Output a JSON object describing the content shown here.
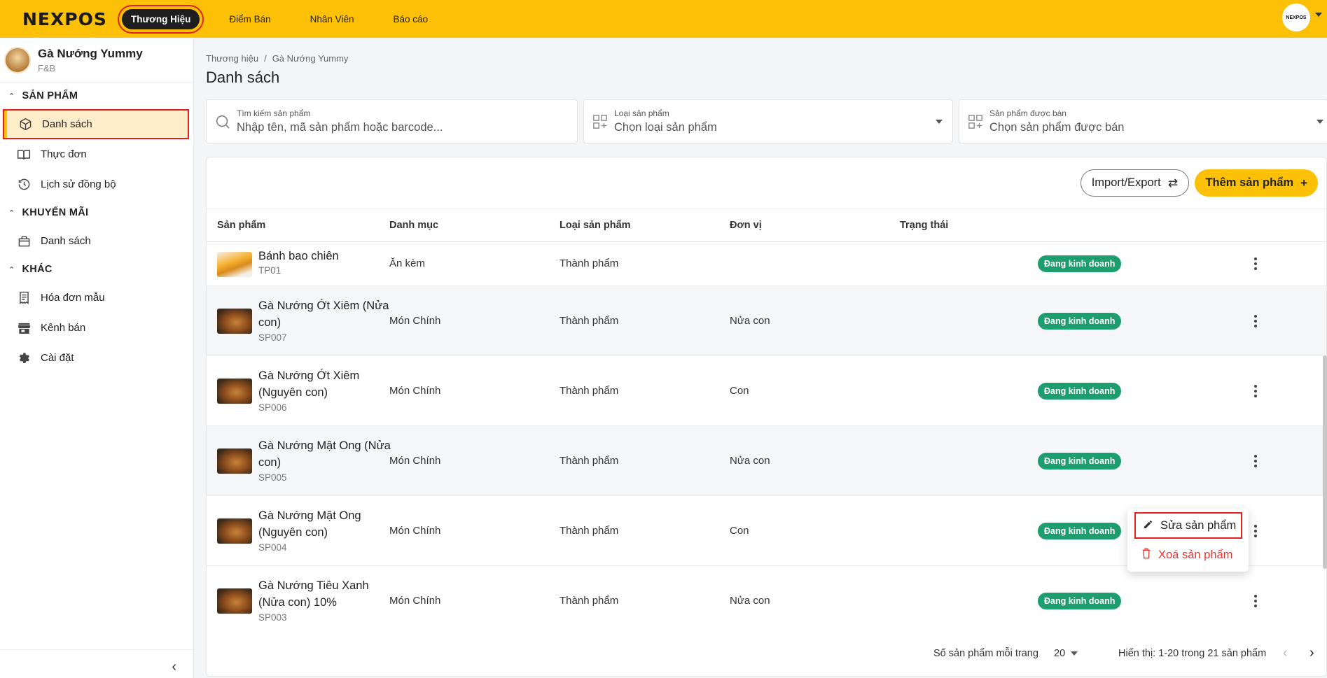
{
  "topbar": {
    "logo": "NEXPOS",
    "nav": [
      {
        "label": "Thương Hiệu",
        "active": true
      },
      {
        "label": "Điểm Bán"
      },
      {
        "label": "Nhân Viên"
      },
      {
        "label": "Báo cáo"
      }
    ],
    "avatar_text": "NEXPOS"
  },
  "sidebar": {
    "brand_name": "Gà Nướng Yummy",
    "brand_type": "F&B",
    "sections": [
      {
        "title": "SẢN PHẨM",
        "items": [
          {
            "label": "Danh sách",
            "icon": "box-icon",
            "active": true
          },
          {
            "label": "Thực đơn",
            "icon": "book-icon"
          },
          {
            "label": "Lịch sử đồng bộ",
            "icon": "history-icon"
          }
        ]
      },
      {
        "title": "KHUYẾN MÃI",
        "items": [
          {
            "label": "Danh sách",
            "icon": "gift-icon"
          }
        ]
      },
      {
        "title": "KHÁC",
        "items": [
          {
            "label": "Hóa đơn mẫu",
            "icon": "receipt-icon"
          },
          {
            "label": "Kênh bán",
            "icon": "store-icon"
          },
          {
            "label": "Cài đặt",
            "icon": "gear-icon"
          }
        ]
      }
    ],
    "collapse_icon": "chevron-left-icon"
  },
  "main": {
    "breadcrumb": [
      "Thương hiệu",
      "Gà Nướng Yummy"
    ],
    "title": "Danh sách",
    "filters": {
      "search": {
        "label": "Tìm kiếm sản phẩm",
        "placeholder": "Nhập tên, mã sản phẩm hoặc barcode..."
      },
      "type": {
        "label": "Loại sản phẩm",
        "value": "Chọn loại sản phẩm"
      },
      "sold": {
        "label": "Sản phẩm được bán",
        "value": "Chọn sản phẩm được bán"
      }
    },
    "actions": {
      "import_export": "Import/Export",
      "add_product": "Thêm sản phẩm"
    },
    "table": {
      "columns": [
        "Sản phẩm",
        "Danh mục",
        "Loại sản phẩm",
        "Đơn vị",
        "Trạng thái"
      ],
      "rows": [
        {
          "name": "Bánh bao chiên",
          "code": "TP01",
          "category": "Ăn kèm",
          "type": "Thành phẩm",
          "unit": "",
          "status": "Đang kinh doanh"
        },
        {
          "name": "Gà Nướng Ớt Xiêm (Nửa con)",
          "code": "SP007",
          "category": "Món Chính",
          "type": "Thành phẩm",
          "unit": "Nửa con",
          "status": "Đang kinh doanh"
        },
        {
          "name": "Gà Nướng Ớt Xiêm (Nguyên con)",
          "code": "SP006",
          "category": "Món Chính",
          "type": "Thành phẩm",
          "unit": "Con",
          "status": "Đang kinh doanh"
        },
        {
          "name": "Gà Nướng Mật Ong (Nửa con)",
          "code": "SP005",
          "category": "Món Chính",
          "type": "Thành phẩm",
          "unit": "Nửa con",
          "status": "Đang kinh doanh"
        },
        {
          "name": "Gà Nướng Mật Ong (Nguyên con)",
          "code": "SP004",
          "category": "Món Chính",
          "type": "Thành phẩm",
          "unit": "Con",
          "status": "Đang kinh doanh"
        },
        {
          "name": "Gà Nướng Tiêu Xanh (Nửa con) 10%",
          "code": "SP003",
          "category": "Món Chính",
          "type": "Thành phẩm",
          "unit": "Nửa con",
          "status": "Đang kinh doanh"
        }
      ]
    },
    "footer": {
      "per_page_label": "Số sản phẩm mỗi trang",
      "per_page_value": "20",
      "range_text": "Hiển thị: 1-20 trong 21 sản phẩm"
    },
    "context_menu": {
      "edit": "Sửa sản phẩm",
      "delete": "Xoá sản phẩm"
    }
  },
  "colors": {
    "brand_yellow": "#fcc006",
    "status_green": "#1d9e6e",
    "danger": "#e53935",
    "highlight_red": "#e02020"
  }
}
